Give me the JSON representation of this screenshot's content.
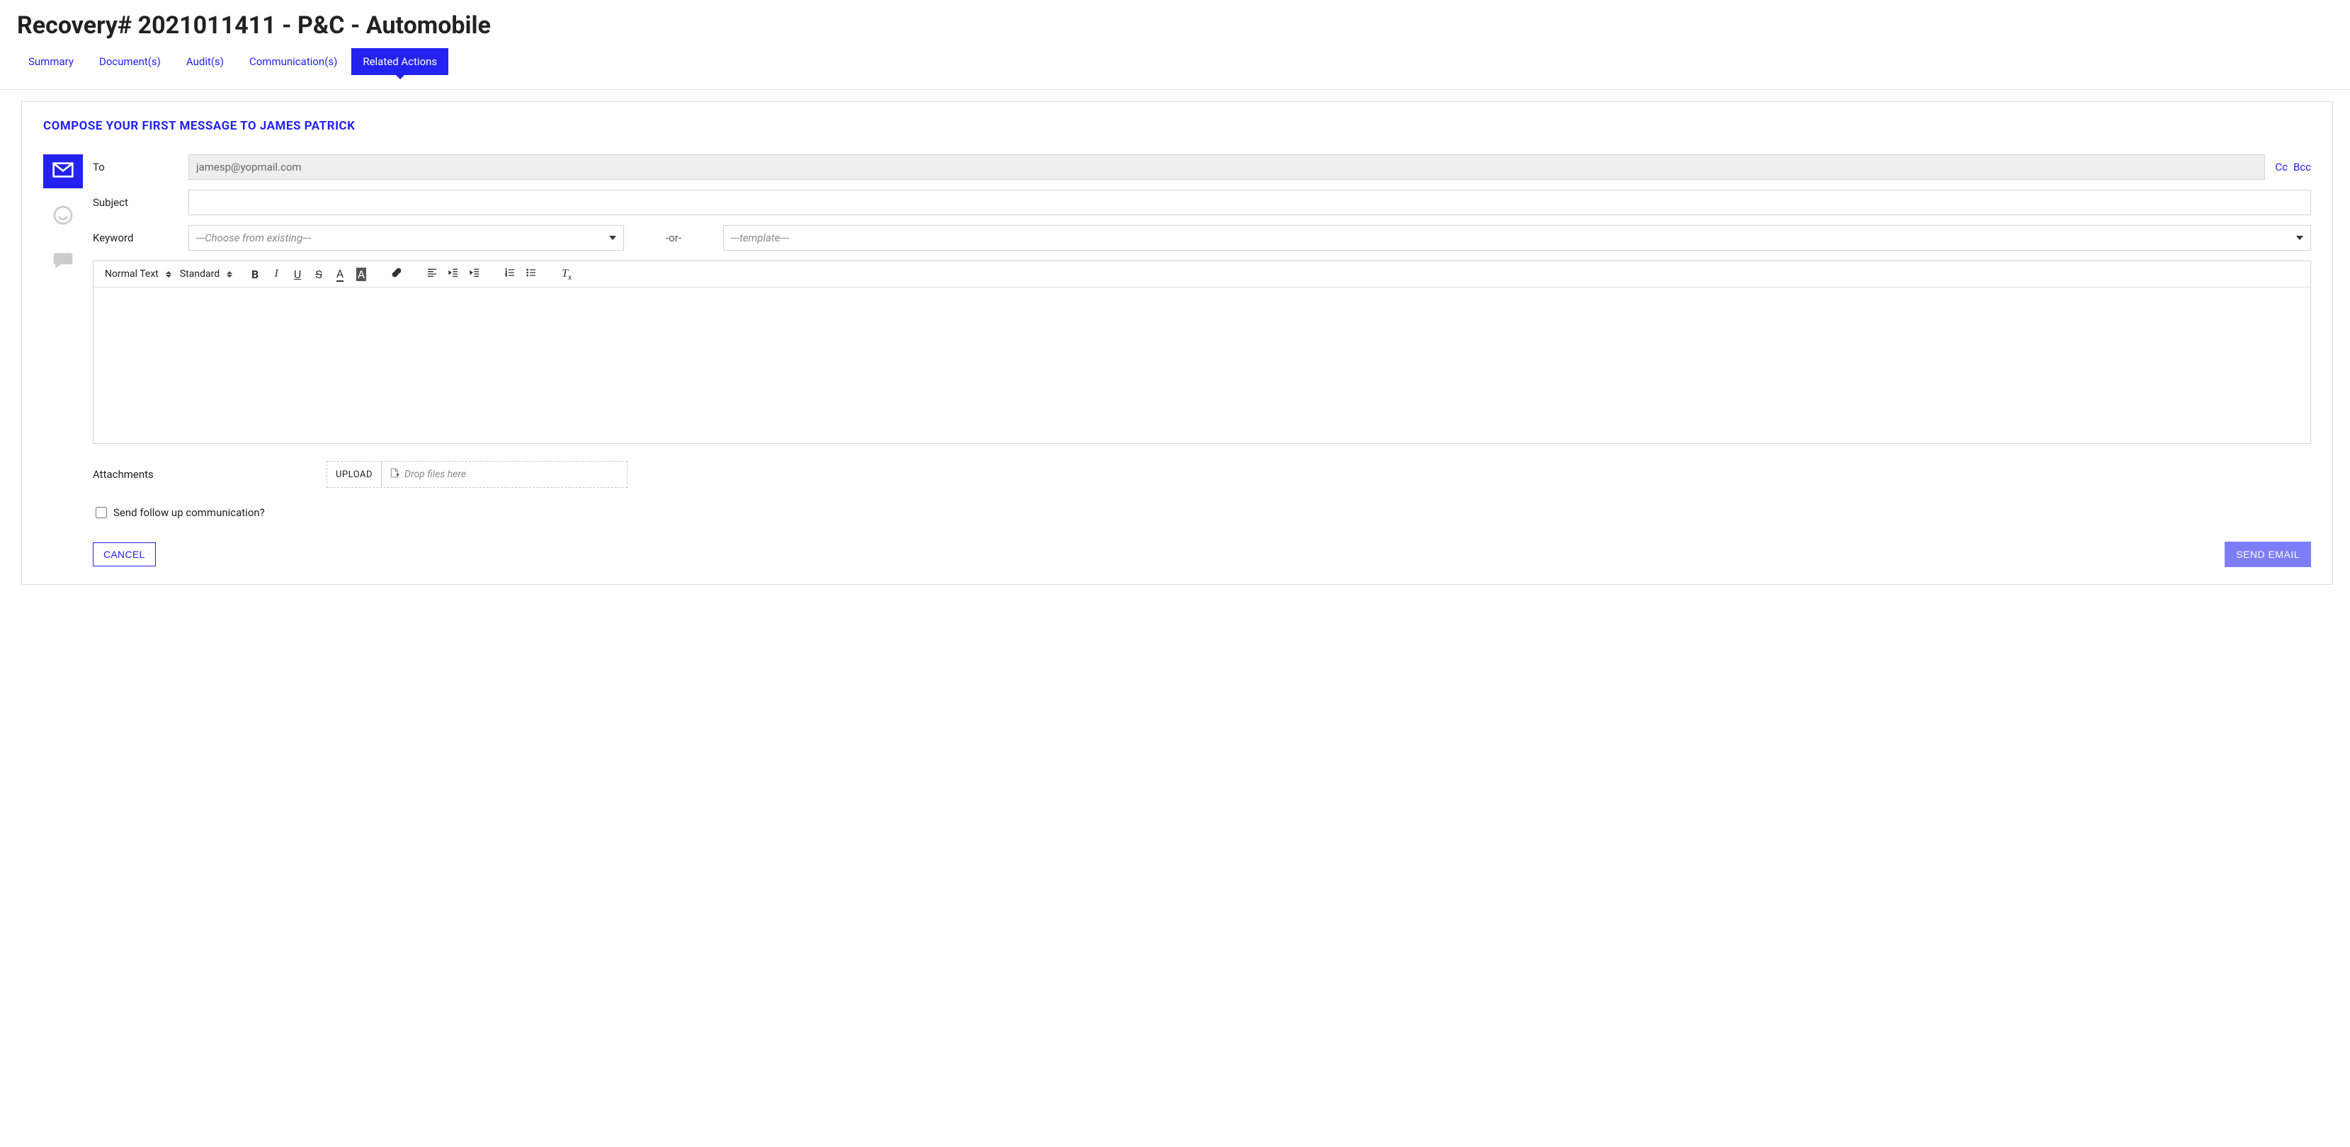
{
  "header": {
    "title": "Recovery# 2021011411 - P&C - Automobile"
  },
  "tabs": [
    {
      "label": "Summary",
      "active": false
    },
    {
      "label": "Document(s)",
      "active": false
    },
    {
      "label": "Audit(s)",
      "active": false
    },
    {
      "label": "Communication(s)",
      "active": false
    },
    {
      "label": "Related Actions",
      "active": true
    }
  ],
  "card": {
    "title": "COMPOSE YOUR FIRST MESSAGE TO JAMES PATRICK"
  },
  "channels": {
    "email": "email-icon",
    "whatsapp": "whatsapp-icon",
    "chat": "chat-icon"
  },
  "fields": {
    "to_label": "To",
    "to_value": "jamesp@yopmail.com",
    "cc_label": "Cc",
    "bcc_label": "Bcc",
    "subject_label": "Subject",
    "subject_value": "",
    "keyword_label": "Keyword",
    "keyword_placeholder": "---Choose from existing---",
    "or_label": "-or-",
    "template_placeholder": "---template---"
  },
  "toolbar": {
    "text_style": "Normal Text",
    "font_size": "Standard"
  },
  "attachments": {
    "label": "Attachments",
    "upload_button": "UPLOAD",
    "drop_text": "Drop files here"
  },
  "followup": {
    "label": "Send follow up communication?",
    "checked": false
  },
  "actions": {
    "cancel": "CANCEL",
    "send": "SEND EMAIL"
  }
}
